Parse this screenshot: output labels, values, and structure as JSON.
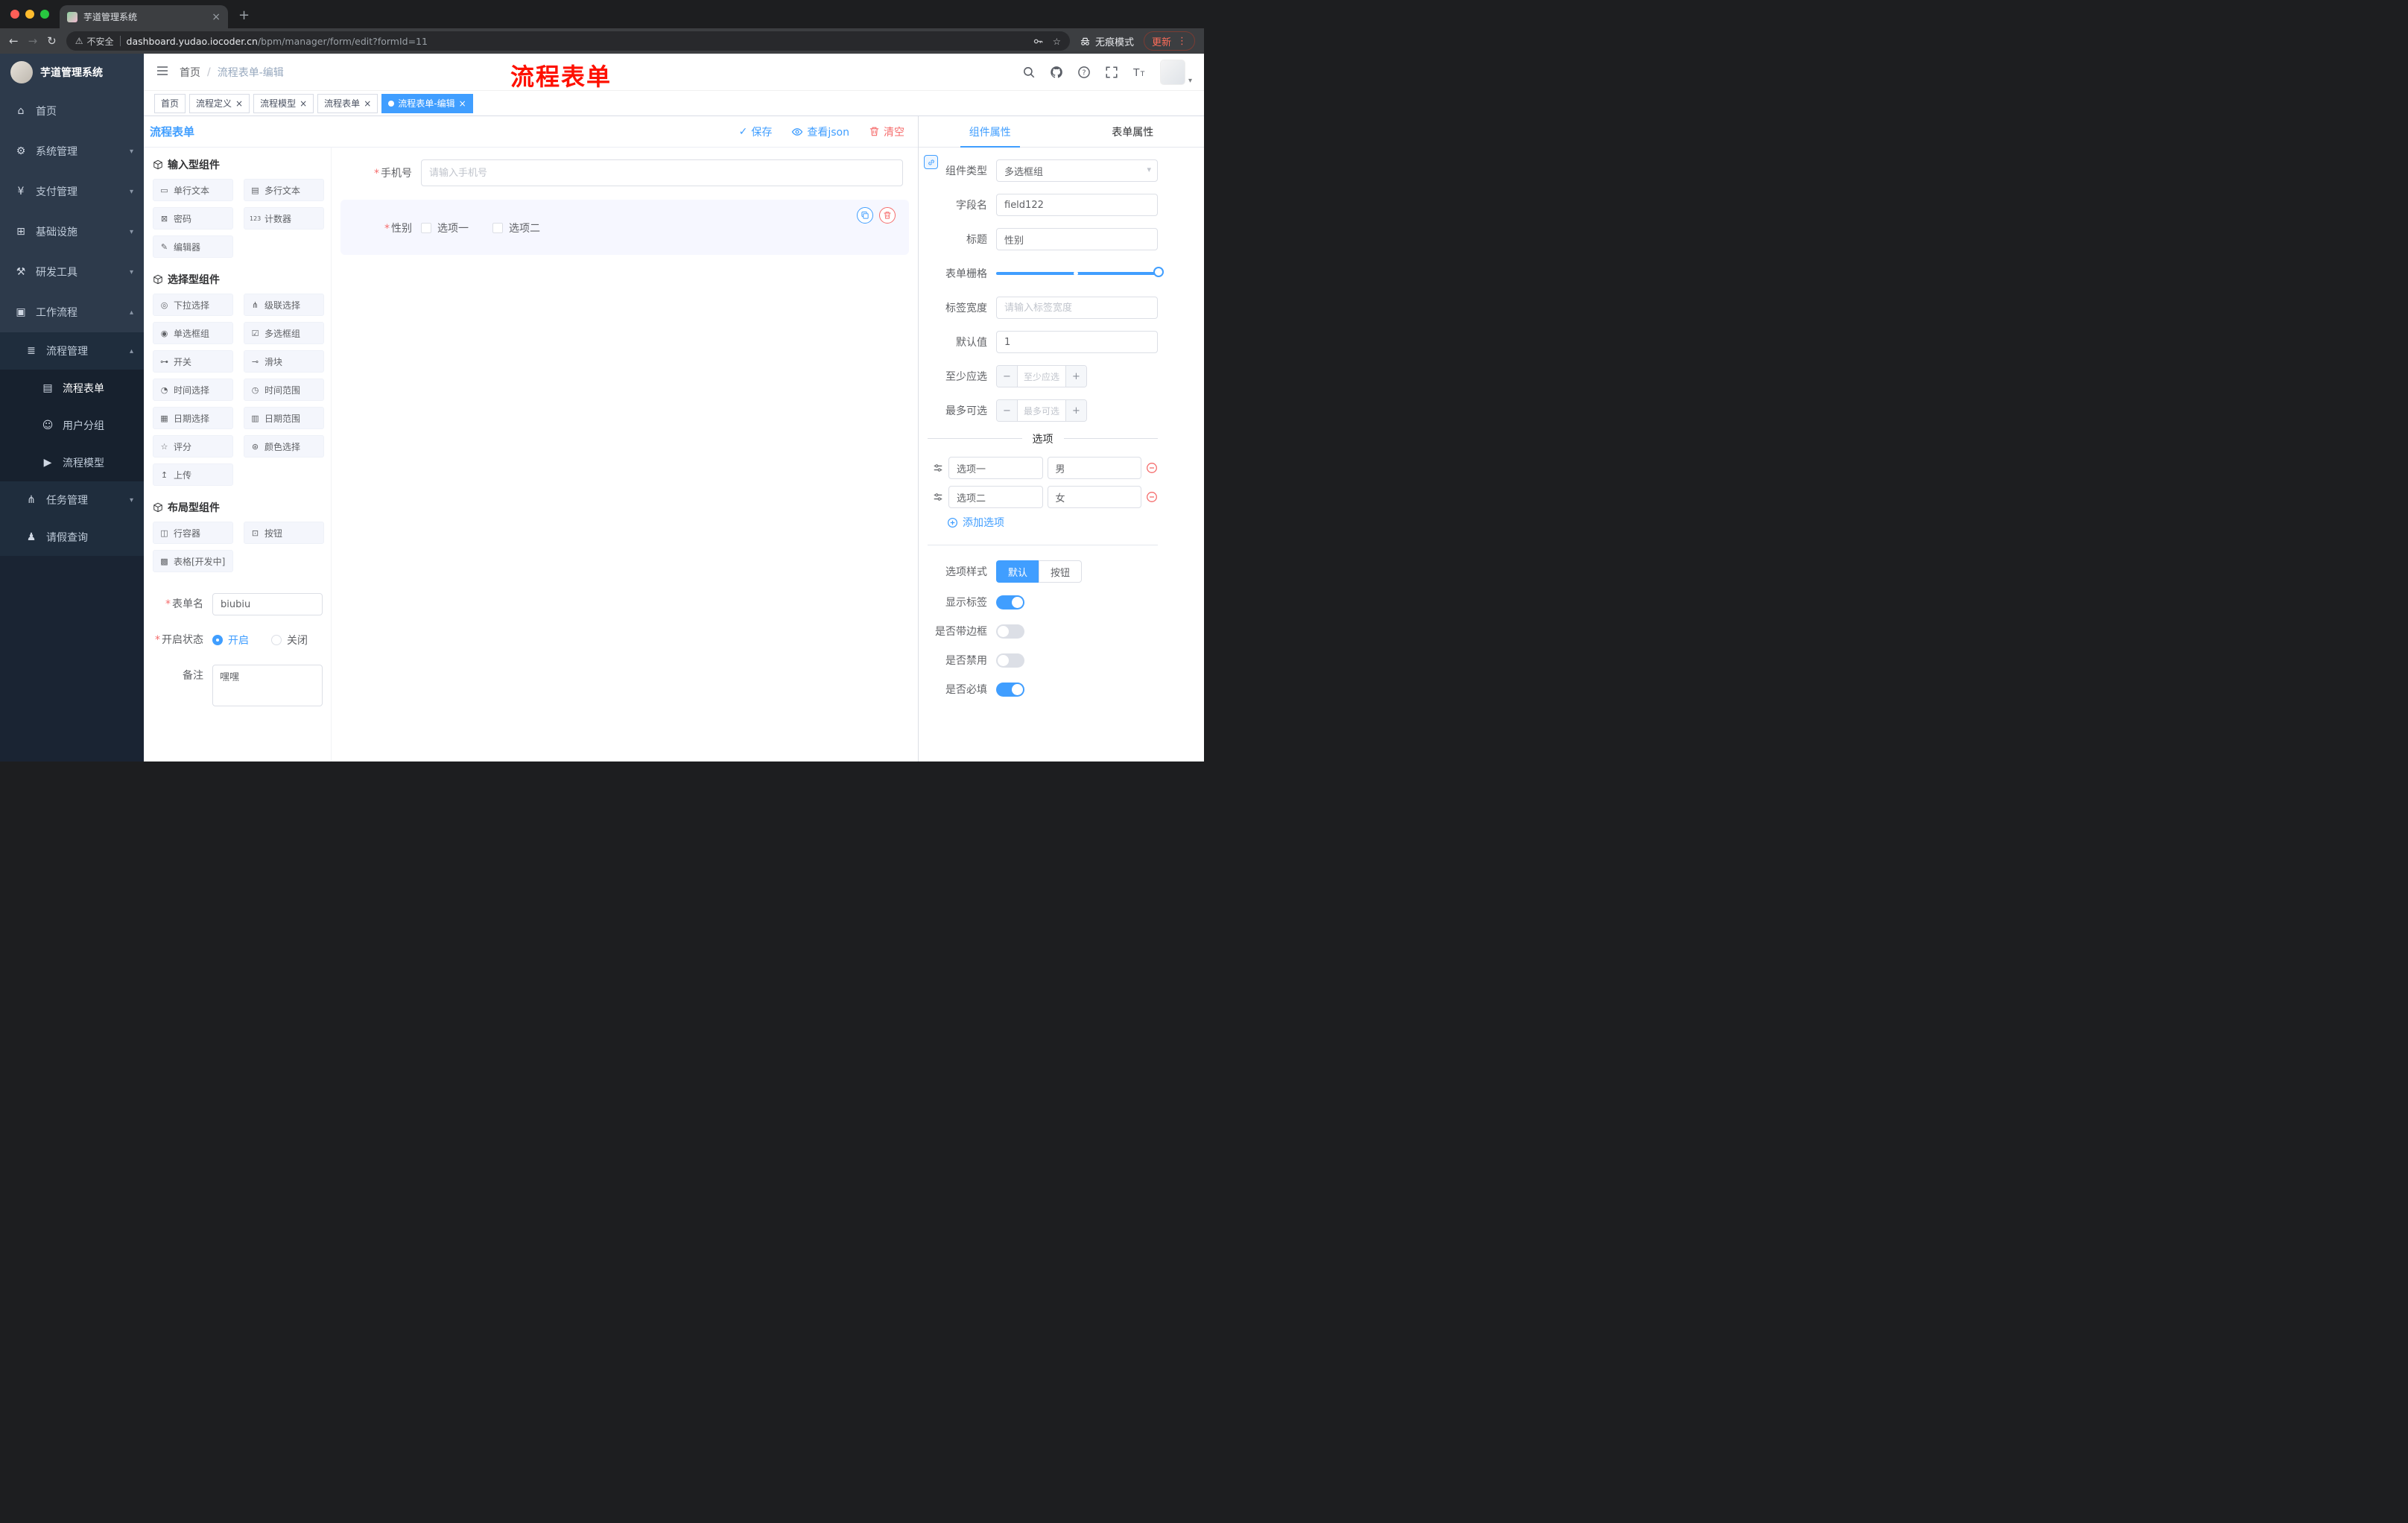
{
  "theme": {
    "accent": "#409EFF",
    "danger": "#F56C6C",
    "annotation_red": "#FE1000",
    "sidebar_bg": "#2D3A4B",
    "sidebar_sub_bg": "#1F2D3D",
    "active_tag_bg": "#409EFF"
  },
  "ui": {
    "required_mark": "*",
    "caret_down": "▾",
    "chevron_down": "▾",
    "chevron_up": "▴",
    "check": "✓",
    "close": "×",
    "plus": "+",
    "minus": "−",
    "back": "←",
    "forward": "→",
    "reload": "↻",
    "warning": "⚠",
    "star": "☆",
    "menu_dots": "⋮",
    "question": "?"
  },
  "browser": {
    "tab_title": "芋道管理系统",
    "security_chip": "不安全",
    "url_domain": "dashboard.yudao.iocoder.cn",
    "url_path": "/bpm/manager/form/edit?formId=11",
    "incognito_label": "无痕模式",
    "update_label": "更新"
  },
  "annotation": {
    "text": "流程表单"
  },
  "sidebar": {
    "logo_title": "芋道管理系统",
    "items": [
      {
        "label": "首页",
        "icon": "⌂"
      },
      {
        "label": "系统管理",
        "icon": "⚙",
        "chevron": "▾"
      },
      {
        "label": "支付管理",
        "icon": "¥",
        "chevron": "▾"
      },
      {
        "label": "基础设施",
        "icon": "⊞",
        "chevron": "▾"
      },
      {
        "label": "研发工具",
        "icon": "⚒",
        "chevron": "▾"
      },
      {
        "label": "工作流程",
        "icon": "▣",
        "chevron": "▴"
      },
      {
        "label": "流程管理",
        "icon": "≣",
        "chevron": "▴"
      },
      {
        "label": "流程表单",
        "icon": "▤"
      },
      {
        "label": "用户分组",
        "icon": "☺"
      },
      {
        "label": "流程模型",
        "icon": "▶"
      },
      {
        "label": "任务管理",
        "icon": "⋔",
        "chevron": "▾"
      },
      {
        "label": "请假查询",
        "icon": "♟"
      }
    ]
  },
  "header": {
    "breadcrumb_home": "首页",
    "breadcrumb_sep": "/",
    "breadcrumb_current": "流程表单-编辑"
  },
  "tags": [
    {
      "label": "首页"
    },
    {
      "label": "流程定义",
      "close": "×"
    },
    {
      "label": "流程模型",
      "close": "×"
    },
    {
      "label": "流程表单",
      "close": "×"
    },
    {
      "label": "流程表单-编辑",
      "close": "×",
      "active": true
    }
  ],
  "designer": {
    "title": "流程表单",
    "save_label": "保存",
    "view_json_label": "查看json",
    "clear_label": "清空",
    "sections": [
      {
        "title": "输入型组件",
        "items": [
          {
            "icon": "▭",
            "label": "单行文本"
          },
          {
            "icon": "▤",
            "label": "多行文本"
          },
          {
            "icon": "⊠",
            "label": "密码"
          },
          {
            "icon": "123",
            "label": "计数器"
          },
          {
            "icon": "✎",
            "label": "编辑器"
          }
        ]
      },
      {
        "title": "选择型组件",
        "items": [
          {
            "icon": "◎",
            "label": "下拉选择"
          },
          {
            "icon": "⋔",
            "label": "级联选择"
          },
          {
            "icon": "◉",
            "label": "单选框组"
          },
          {
            "icon": "☑",
            "label": "多选框组"
          },
          {
            "icon": "⊶",
            "label": "开关"
          },
          {
            "icon": "⊸",
            "label": "滑块"
          },
          {
            "icon": "◔",
            "label": "时间选择"
          },
          {
            "icon": "◷",
            "label": "时间范围"
          },
          {
            "icon": "▦",
            "label": "日期选择"
          },
          {
            "icon": "▥",
            "label": "日期范围"
          },
          {
            "icon": "☆",
            "label": "评分"
          },
          {
            "icon": "⊛",
            "label": "颜色选择"
          },
          {
            "icon": "↥",
            "label": "上传"
          }
        ]
      },
      {
        "title": "布局型组件",
        "items": [
          {
            "icon": "◫",
            "label": "行容器"
          },
          {
            "icon": "⊡",
            "label": "按钮"
          },
          {
            "icon": "▩",
            "label": "表格[开发中]"
          }
        ]
      }
    ],
    "meta": {
      "name_label": "表单名",
      "name_value": "biubiu",
      "status_label": "开启状态",
      "status_on": "开启",
      "status_off": "关闭",
      "remark_label": "备注",
      "remark_value": "嘿嘿"
    },
    "canvas": {
      "phone_label": "手机号",
      "phone_placeholder": "请输入手机号",
      "gender_label": "性别",
      "gender_opt1": "选项一",
      "gender_opt2": "选项二"
    }
  },
  "props": {
    "tab_component": "组件属性",
    "tab_form": "表单属性",
    "rows": {
      "type_label": "组件类型",
      "type_value": "多选框组",
      "field_label": "字段名",
      "field_value": "field122",
      "title_label": "标题",
      "title_value": "性别",
      "grid_label": "表单栅格",
      "width_label": "标签宽度",
      "width_placeholder": "请输入标签宽度",
      "default_label": "默认值",
      "default_value": "1",
      "min_label": "至少应选",
      "min_placeholder": "至少应选",
      "max_label": "最多可选",
      "max_placeholder": "最多可选"
    },
    "options_title": "选项",
    "options": [
      {
        "label": "选项一",
        "value": "男"
      },
      {
        "label": "选项二",
        "value": "女"
      }
    ],
    "add_option": "添加选项",
    "style_label": "选项样式",
    "style_default": "默认",
    "style_button": "按钮",
    "toggles": [
      {
        "label": "显示标签",
        "on": true
      },
      {
        "label": "是否带边框",
        "on": false
      },
      {
        "label": "是否禁用",
        "on": false
      },
      {
        "label": "是否必填",
        "on": true
      }
    ]
  }
}
